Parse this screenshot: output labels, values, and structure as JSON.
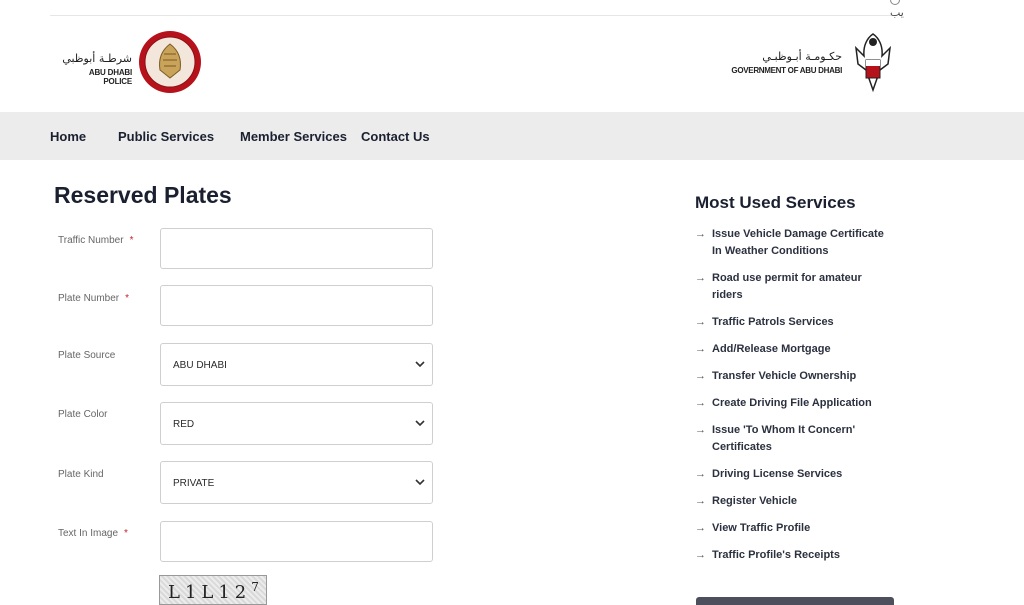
{
  "topbar": {
    "lang_label": "يب"
  },
  "header": {
    "police": {
      "name_ar": "شرطـة أبوظبي",
      "name_en": "ABU DHABI POLICE"
    },
    "government": {
      "name_ar": "حكـومـة أبـوظبـي",
      "name_en": "GOVERNMENT OF ABU DHABI"
    }
  },
  "nav": {
    "items": [
      "Home",
      "Public Services",
      "Member Services",
      "Contact Us"
    ]
  },
  "page": {
    "title": "Reserved Plates"
  },
  "form": {
    "traffic_number": {
      "label": "Traffic Number",
      "required": "*",
      "value": ""
    },
    "plate_number": {
      "label": "Plate Number",
      "required": "*",
      "value": ""
    },
    "plate_source": {
      "label": "Plate Source",
      "value": "ABU DHABI"
    },
    "plate_color": {
      "label": "Plate Color",
      "value": "RED"
    },
    "plate_kind": {
      "label": "Plate Kind",
      "value": "PRIVATE"
    },
    "text_in_image": {
      "label": "Text In Image",
      "required": "*",
      "value": ""
    },
    "captcha": {
      "text": "L1L12",
      "superscript": "7"
    }
  },
  "sidebar": {
    "title": "Most Used Services",
    "items": [
      "Issue Vehicle Damage Certificate In Weather Conditions",
      "Road use permit for amateur riders",
      "Traffic Patrols Services",
      "Add/Release Mortgage",
      "Transfer Vehicle Ownership",
      "Create Driving File Application",
      "Issue 'To Whom It Concern' Certificates",
      "Driving License Services",
      "Register Vehicle",
      "View Traffic Profile",
      "Traffic Profile's Receipts"
    ]
  },
  "colors": {
    "accent_red": "#b5121b",
    "nav_bg": "#ececec",
    "text_dark": "#1b2030"
  }
}
